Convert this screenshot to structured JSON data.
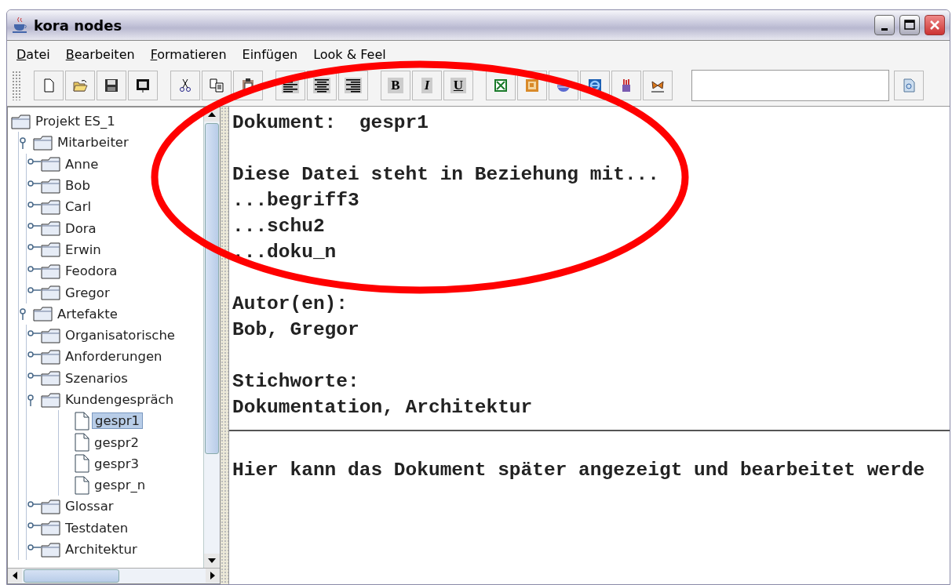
{
  "window": {
    "title": "kora nodes"
  },
  "menu": [
    {
      "label": "Datei",
      "mnemonic": true
    },
    {
      "label": "Bearbeiten",
      "mnemonic": true
    },
    {
      "label": "Formatieren",
      "mnemonic": true
    },
    {
      "label": "Einfügen",
      "mnemonic": false
    },
    {
      "label": "Look & Feel",
      "mnemonic": false
    }
  ],
  "toolbar": {
    "format_buttons": [
      "B",
      "I",
      "U"
    ]
  },
  "tree": {
    "label": "Projekt ES_1",
    "kind": "folder",
    "selected": false,
    "children": [
      {
        "label": "Mitarbeiter",
        "kind": "folder",
        "expanded": true,
        "selected": false,
        "children": [
          {
            "label": "Anne",
            "kind": "folder",
            "expanded": false,
            "selected": false
          },
          {
            "label": "Bob",
            "kind": "folder",
            "expanded": false,
            "selected": false
          },
          {
            "label": "Carl",
            "kind": "folder",
            "expanded": false,
            "selected": false
          },
          {
            "label": "Dora",
            "kind": "folder",
            "expanded": false,
            "selected": false
          },
          {
            "label": "Erwin",
            "kind": "folder",
            "expanded": false,
            "selected": false
          },
          {
            "label": "Feodora",
            "kind": "folder",
            "expanded": false,
            "selected": false
          },
          {
            "label": "Gregor",
            "kind": "folder",
            "expanded": false,
            "selected": false
          }
        ]
      },
      {
        "label": "Artefakte",
        "kind": "folder",
        "expanded": true,
        "selected": false,
        "children": [
          {
            "label": "Organisatorische",
            "kind": "folder",
            "expanded": false,
            "selected": false
          },
          {
            "label": "Anforderungen",
            "kind": "folder",
            "expanded": false,
            "selected": false
          },
          {
            "label": "Szenarios",
            "kind": "folder",
            "expanded": false,
            "selected": false
          },
          {
            "label": "Kundengespräch",
            "kind": "folder",
            "expanded": true,
            "selected": false,
            "children": [
              {
                "label": "gespr1",
                "kind": "document",
                "selected": true
              },
              {
                "label": "gespr2",
                "kind": "document",
                "selected": false
              },
              {
                "label": "gespr3",
                "kind": "document",
                "selected": false
              },
              {
                "label": "gespr_n",
                "kind": "document",
                "selected": false
              }
            ]
          },
          {
            "label": "Glossar",
            "kind": "folder",
            "expanded": false,
            "selected": false
          },
          {
            "label": "Testdaten",
            "kind": "folder",
            "expanded": false,
            "selected": false
          },
          {
            "label": "Architektur",
            "kind": "folder",
            "expanded": false,
            "selected": false
          }
        ]
      }
    ]
  },
  "document": {
    "blocks": [
      [
        "Dokument:  gespr1"
      ],
      [
        "Diese Datei steht in Beziehung mit...",
        "...begriff3",
        "...schu2",
        "...doku_n"
      ],
      [
        "Autor(en):",
        "Bob, Gregor"
      ],
      [
        "Stichworte:",
        "Dokumentation, Architektur"
      ]
    ],
    "preview": "Hier kann das Dokument später angezeigt und bearbeitet werde"
  }
}
